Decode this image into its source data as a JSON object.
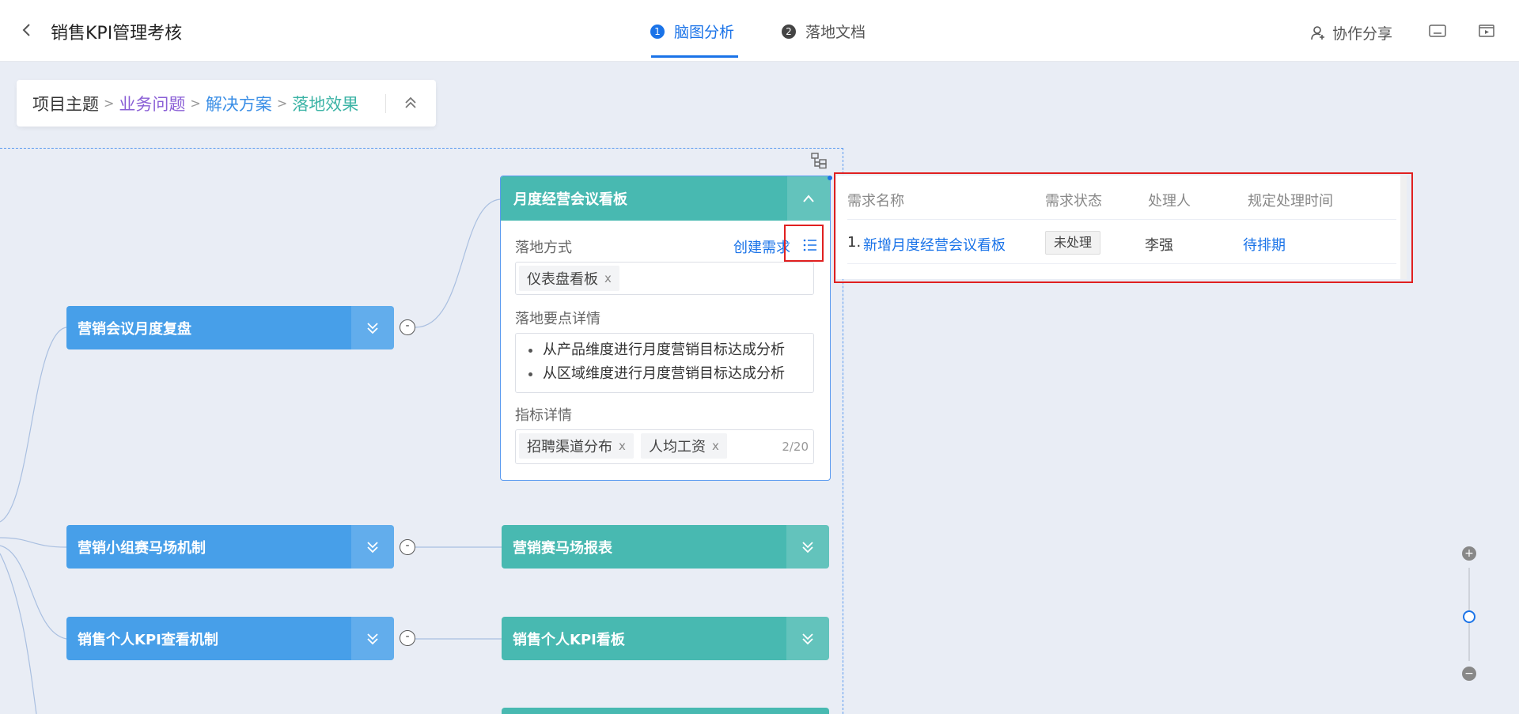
{
  "header": {
    "title": "销售KPI管理考核",
    "steps": [
      {
        "num": "1",
        "label": "脑图分析"
      },
      {
        "num": "2",
        "label": "落地文档"
      }
    ],
    "share_label": "协作分享"
  },
  "breadcrumb": [
    "项目主题",
    "业务问题",
    "解决方案",
    "落地效果"
  ],
  "nodes_left": [
    {
      "label": "营销会议月度复盘"
    },
    {
      "label": "营销小组赛马场机制"
    },
    {
      "label": "销售个人KPI查看机制"
    }
  ],
  "nodes_right": [
    {
      "label": "营销赛马场报表"
    },
    {
      "label": "销售个人KPI看板"
    }
  ],
  "card": {
    "title": "月度经营会议看板",
    "method_label": "落地方式",
    "create_label": "创建需求",
    "method_tag": "仪表盘看板",
    "points_label": "落地要点详情",
    "points": [
      "从产品维度进行月度营销目标达成分析",
      "从区域维度进行月度营销目标达成分析"
    ],
    "metrics_label": "指标详情",
    "metrics": [
      "招聘渠道分布",
      "人均工资"
    ],
    "metrics_count": "2/20",
    "close": "x"
  },
  "requirements": {
    "headers": [
      "需求名称",
      "需求状态",
      "处理人",
      "规定处理时间"
    ],
    "rows": [
      {
        "index": "1.",
        "name": "新增月度经营会议看板",
        "status": "未处理",
        "owner": "李强",
        "due": "待排期"
      }
    ]
  },
  "zoom": {
    "plus": "+",
    "minus": "−",
    "level": 0.55
  },
  "colors": {
    "accent": "#1a73e8",
    "node_blue": "#479fe9",
    "node_teal": "#48b9b1",
    "annotation": "#e02020"
  }
}
